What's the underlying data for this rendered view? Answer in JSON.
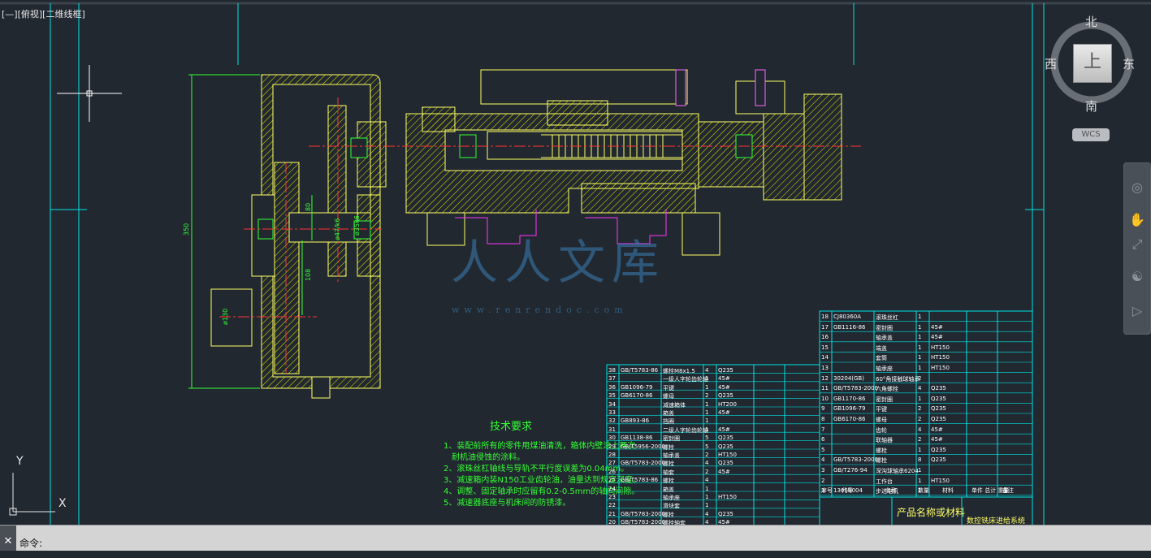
{
  "viewport": {
    "label": "[—][俯视][二维线框]"
  },
  "viewcube": {
    "north": "北",
    "south": "南",
    "east": "东",
    "west": "西",
    "face": "上",
    "wcs": "WCS"
  },
  "navbar": {
    "icons": [
      "steering-wheel-icon",
      "pan-icon",
      "zoom-icon",
      "orbit-icon",
      "showmotion-icon"
    ]
  },
  "ucs": {
    "x": "X",
    "y": "Y"
  },
  "drawing": {
    "tech_title": "技术要求",
    "notes": [
      "1、装配前所有的零件用煤油清洗，箱体内壁涂上两次",
      "耐机油侵蚀的涂料。",
      "2、滚珠丝杠轴线与导轨不平行度误差为0.04mm。",
      "3、减速箱内装N150工业齿轮油，油量达到规定深度。",
      "4、调整、固定轴承时应留有0.2-0.5mm的轴向间隙。",
      "5、减速器底座与机床间的防锈漆。"
    ],
    "watermark": "人人文库",
    "watermark_url": "www.renrendoc.com",
    "dimensions": [
      "350",
      "108",
      "80",
      "ø130",
      "ø47/k6",
      "ø35k6"
    ],
    "product_name": "产品名称或材料",
    "bom_header": [
      "序号",
      "代号",
      "名称",
      "数量",
      "材料",
      "单件 总计 重量",
      "备注"
    ],
    "bom_right": [
      [
        "18",
        "CJ80360A",
        "滚珠丝杠",
        "1",
        ""
      ],
      [
        "17",
        "GB1116-86",
        "密封圈",
        "1",
        "45#"
      ],
      [
        "16",
        "",
        "轴承盖",
        "1",
        "45#"
      ],
      [
        "15",
        "",
        "端盖",
        "1",
        "HT150"
      ],
      [
        "14",
        "",
        "套筒",
        "1",
        "HT150"
      ],
      [
        "13",
        "",
        "轴承座",
        "1",
        "HT150"
      ],
      [
        "12",
        "30204(GB)",
        "60°角接触球轴承",
        "2",
        ""
      ],
      [
        "11",
        "GB/T5783-2000",
        "六角螺栓",
        "4",
        "Q235"
      ],
      [
        "10",
        "GB1170-86",
        "密封圈",
        "1",
        "Q235"
      ],
      [
        "9",
        "GB1096-79",
        "平键",
        "2",
        "Q235"
      ],
      [
        "8",
        "GB6170-86",
        "螺母",
        "2",
        "Q235"
      ],
      [
        "7",
        "",
        "齿轮",
        "4",
        "45#"
      ],
      [
        "6",
        "",
        "联轴器",
        "2",
        "45#"
      ],
      [
        "5",
        "",
        "螺栓",
        "1",
        "Q235"
      ],
      [
        "4",
        "GB/T5783-2000",
        "螺栓",
        "8",
        "Q235"
      ],
      [
        "3",
        "GB/T276-94",
        "深沟球轴承6204",
        "1",
        ""
      ],
      [
        "2",
        "",
        "工作台",
        "1",
        "HT150"
      ],
      [
        "1",
        "130SB004",
        "步进电机",
        "1",
        ""
      ]
    ],
    "bom_left": [
      [
        "38",
        "GB/T5783-86",
        "螺栓M8x1.5",
        "4",
        "Q235"
      ],
      [
        "37",
        "",
        "一级人字轮齿轮轴",
        "1",
        "45#"
      ],
      [
        "36",
        "GB1096-79",
        "平键",
        "1",
        "45#"
      ],
      [
        "35",
        "GB6170-86",
        "螺母",
        "2",
        "Q235"
      ],
      [
        "34",
        "",
        "减速箱体",
        "1",
        "HT200"
      ],
      [
        "33",
        "",
        "箱盖",
        "1",
        "45#"
      ],
      [
        "32",
        "GB893-86",
        "挡圈",
        "1",
        ""
      ],
      [
        "31",
        "",
        "二级人字轮齿轮轴",
        "1",
        "45#"
      ],
      [
        "30",
        "GB1138-86",
        "密封圈",
        "5",
        "Q235"
      ],
      [
        "29",
        "GB/T5956-2000",
        "螺栓",
        "5",
        "Q235"
      ],
      [
        "28",
        "",
        "轴承盖",
        "2",
        "HT150"
      ],
      [
        "27",
        "GB/T5783-2000",
        "螺栓",
        "4",
        "Q235"
      ],
      [
        "26",
        "",
        "轴套",
        "2",
        "45#"
      ],
      [
        "25",
        "GB/T5783-86",
        "螺栓",
        "4",
        ""
      ],
      [
        "24",
        "",
        "箱盖",
        "1",
        ""
      ],
      [
        "23",
        "",
        "轴承座",
        "1",
        "HT150"
      ],
      [
        "22",
        "",
        "滑块套",
        "1",
        ""
      ],
      [
        "21",
        "GB/T5783-2000",
        "螺栓",
        "4",
        "Q235"
      ],
      [
        "20",
        "GB/T5783-2000",
        "螺栓轴套",
        "4",
        "45#"
      ]
    ],
    "title_block_name": "数控铣床进给系统"
  },
  "command": {
    "prompt": "命令:",
    "value": ""
  },
  "colors": {
    "background": "#212830",
    "hatch": "#e6e600",
    "outline": "#ffff66",
    "dimension": "#33ff33",
    "frame": "#00e5e5",
    "centerline": "#ff3333",
    "profile": "#ff33ff",
    "fastener": "#ff66ff"
  }
}
